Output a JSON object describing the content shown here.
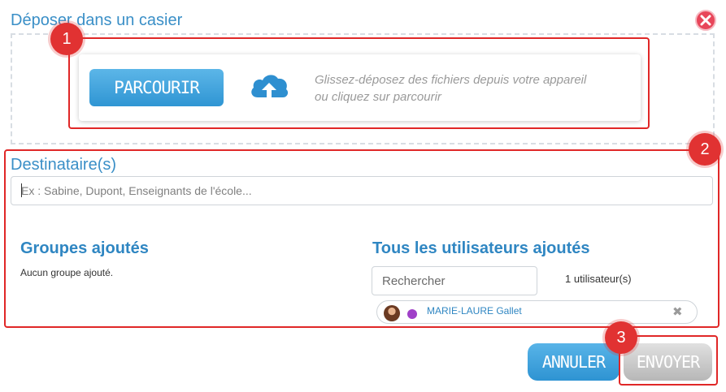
{
  "dialog": {
    "title": "Déposer dans un casier",
    "close_icon": "close-icon",
    "close_color": "#e8465a"
  },
  "dropzone": {
    "browse_label": "PARCOURIR",
    "upload_icon": "cloud-upload-icon",
    "hint_line1": "Glissez-déposez des fichiers depuis votre appareil",
    "hint_line2": "ou cliquez sur parcourir"
  },
  "annotations": [
    "1",
    "2",
    "3"
  ],
  "recipients": {
    "label": "Destinataire(s)",
    "placeholder": "Ex : Sabine, Dupont, Enseignants de l'école..."
  },
  "groups": {
    "heading": "Groupes ajoutés",
    "empty_text": "Aucun groupe ajouté."
  },
  "users": {
    "heading": "Tous les utilisateurs ajoutés",
    "search_placeholder": "Rechercher",
    "count_text": "1 utilisateur(s)",
    "items": [
      {
        "name": "MARIE-LAURE Gallet",
        "status_color": "#a040c8",
        "remove_icon": "remove-x-icon"
      }
    ]
  },
  "actions": {
    "cancel_label": "ANNULER",
    "send_label": "ENVOYER"
  },
  "colors": {
    "accent": "#3a8fc7",
    "annotation_red": "#e02727",
    "button_blue": "#2f95d3",
    "button_disabled": "#b7b7b7"
  }
}
